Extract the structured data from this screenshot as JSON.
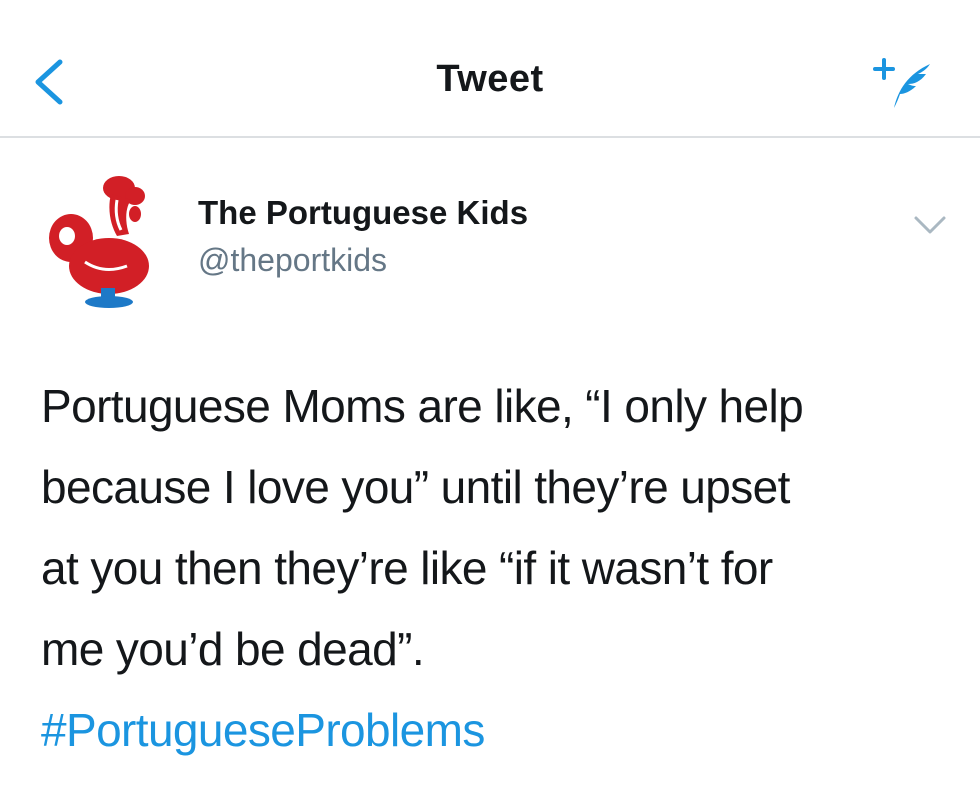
{
  "nav": {
    "title": "Tweet",
    "back_icon": "chevron-left-icon",
    "compose_icon": "compose-tweet-icon"
  },
  "author": {
    "name": "The Portuguese Kids",
    "handle": "@theportkids",
    "avatar_icon": "rooster-of-barcelos-icon",
    "more_icon": "chevron-down-icon"
  },
  "tweet": {
    "text": "Portuguese Moms are like, “I only help\nbecause I love you” until they’re upset\nat you then they’re like “if it wasn’t for\nme you’d be dead”.",
    "hashtag": "#PortugueseProblems"
  },
  "colors": {
    "accent": "#1b95e0",
    "text": "#14171a",
    "secondary_text": "#657786",
    "divider": "#dcdfe2",
    "avatar_red": "#d21f26",
    "avatar_blue": "#1d79c7"
  }
}
